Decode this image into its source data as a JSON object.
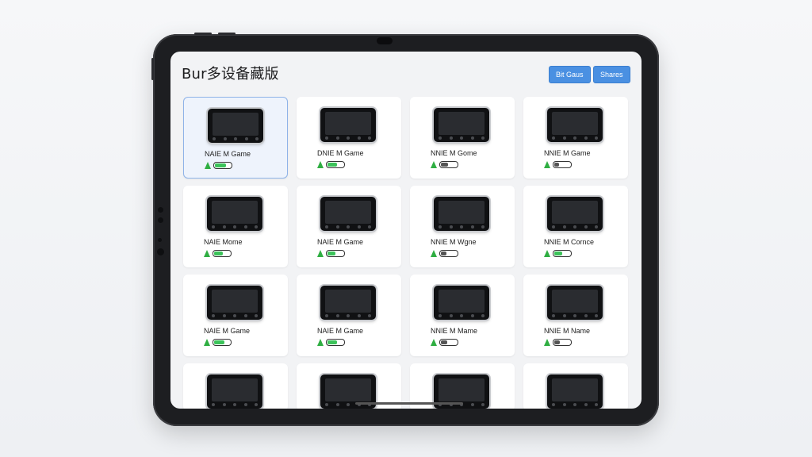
{
  "app": {
    "title": "Bur多设备藏版"
  },
  "toolbar": {
    "button1_label": "Bit Gaus",
    "button2_label": "Shares"
  },
  "accent_color": "#4a90e2",
  "battery_color_high": "#3cc35a",
  "battery_color_low": "#555555",
  "devices": [
    {
      "name": "NAIE M Game",
      "battery": 0.75,
      "selected": true
    },
    {
      "name": "DNIE M Game",
      "battery": 0.65,
      "selected": false
    },
    {
      "name": "NNIE M Gome",
      "battery": 0.45,
      "selected": false
    },
    {
      "name": "NNIE M Game",
      "battery": 0.3,
      "selected": false
    },
    {
      "name": "NAIE Mome",
      "battery": 0.6,
      "selected": false
    },
    {
      "name": "NAIE M Game",
      "battery": 0.55,
      "selected": false
    },
    {
      "name": "NNIE M Wgne",
      "battery": 0.35,
      "selected": false
    },
    {
      "name": "NNIE M Cornce",
      "battery": 0.5,
      "selected": false
    },
    {
      "name": "NAIE M Game",
      "battery": 0.7,
      "selected": false
    },
    {
      "name": "NAIE M Game",
      "battery": 0.65,
      "selected": false
    },
    {
      "name": "NNIE M Mame",
      "battery": 0.4,
      "selected": false
    },
    {
      "name": "NNIE M Name",
      "battery": 0.35,
      "selected": false
    },
    {
      "name": "",
      "battery": null,
      "selected": false
    },
    {
      "name": "",
      "battery": null,
      "selected": false
    },
    {
      "name": "",
      "battery": null,
      "selected": false
    },
    {
      "name": "",
      "battery": null,
      "selected": false
    }
  ]
}
